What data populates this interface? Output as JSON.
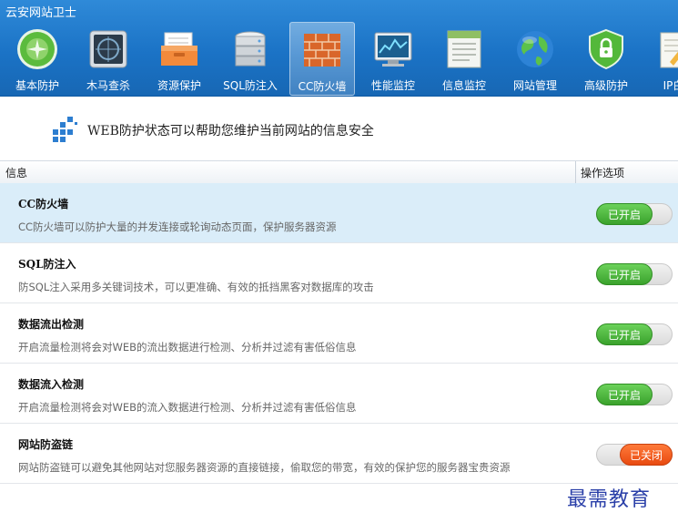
{
  "app": {
    "title": "云安网站卫士"
  },
  "nav": [
    {
      "label": "基本防护",
      "icon": "green-orb-icon"
    },
    {
      "label": "木马查杀",
      "icon": "radar-screen-icon"
    },
    {
      "label": "资源保护",
      "icon": "orange-folder-icon"
    },
    {
      "label": "SQL防注入",
      "icon": "database-icon"
    },
    {
      "label": "CC防火墙",
      "icon": "brick-wall-icon",
      "active": true
    },
    {
      "label": "性能监控",
      "icon": "monitor-chart-icon"
    },
    {
      "label": "信息监控",
      "icon": "document-list-icon"
    },
    {
      "label": "网站管理",
      "icon": "globe-icon"
    },
    {
      "label": "高级防护",
      "icon": "shield-lock-icon"
    },
    {
      "label": "IP白",
      "icon": "pencil-note-icon"
    }
  ],
  "banner": {
    "text": "WEB防护状态可以帮助您维护当前网站的信息安全"
  },
  "table": {
    "col_info": "信息",
    "col_ops": "操作选项"
  },
  "rows": [
    {
      "title": "CC防火墙",
      "desc": "CC防火墙可以防护大量的并发连接或轮询动态页面，保护服务器资源",
      "state": "已开启"
    },
    {
      "title": "SQL防注入",
      "desc": "防SQL注入采用多关键词技术，可以更准确、有效的抵挡黑客对数据库的攻击",
      "state": "已开启"
    },
    {
      "title": "数据流出检测",
      "desc": "开启流量检测将会对WEB的流出数据进行检测、分析并过滤有害低俗信息",
      "state": "已开启"
    },
    {
      "title": "数据流入检测",
      "desc": "开启流量检测将会对WEB的流入数据进行检测、分析并过滤有害低俗信息",
      "state": "已开启"
    },
    {
      "title": "网站防盗链",
      "desc": "网站防盗链可以避免其他网站对您服务器资源的直接链接，偷取您的带宽，有效的保护您的服务器宝贵资源",
      "state": "已关闭"
    }
  ],
  "watermark": "最需教育",
  "colors": {
    "header_blue": "#1b73c6",
    "toggle_on": "#3aa22c",
    "toggle_off": "#e84a10",
    "selected_row": "#daedf9"
  }
}
